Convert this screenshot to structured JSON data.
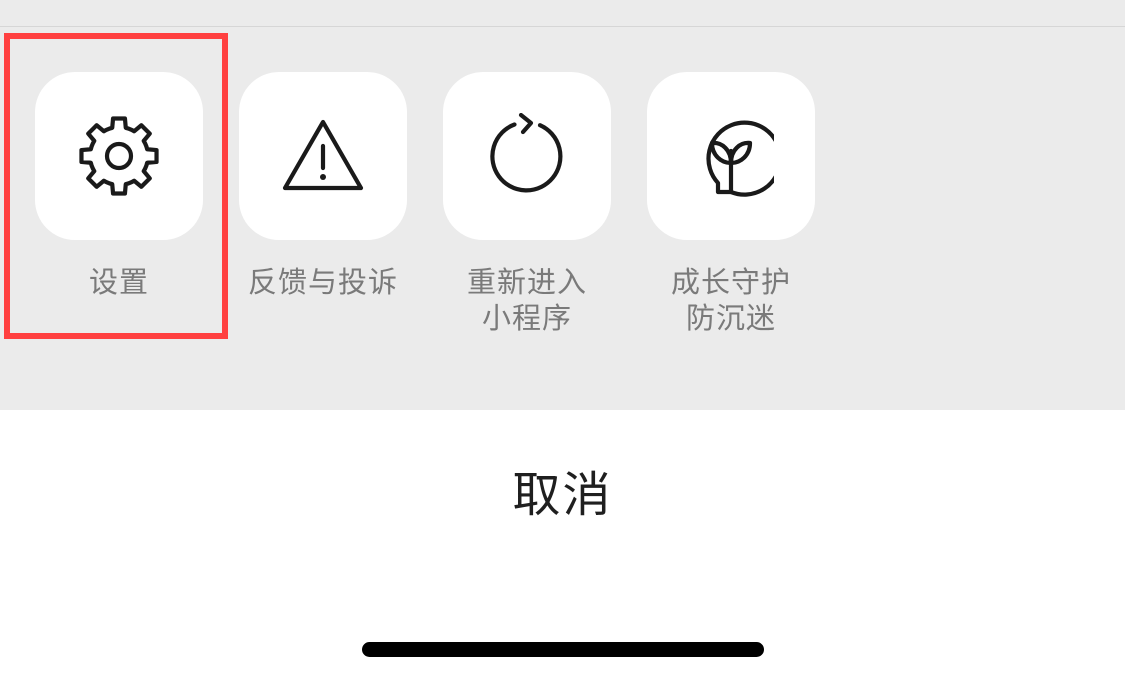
{
  "actions": [
    {
      "icon": "gear-icon",
      "label_lines": [
        "设置"
      ]
    },
    {
      "icon": "warning-triangle-icon",
      "label_lines": [
        "反馈与投诉"
      ]
    },
    {
      "icon": "refresh-icon",
      "label_lines": [
        "重新进入",
        "小程序"
      ]
    },
    {
      "icon": "sprout-icon",
      "label_lines": [
        "成长守护",
        "防沉迷"
      ]
    }
  ],
  "cancel_label": "取消",
  "colors": {
    "sheet_background": "#ebebeb",
    "tile_background": "#ffffff",
    "label_text": "#7a7a7a",
    "highlight": "#ff4040",
    "cancel_text": "#1f1f1f"
  }
}
